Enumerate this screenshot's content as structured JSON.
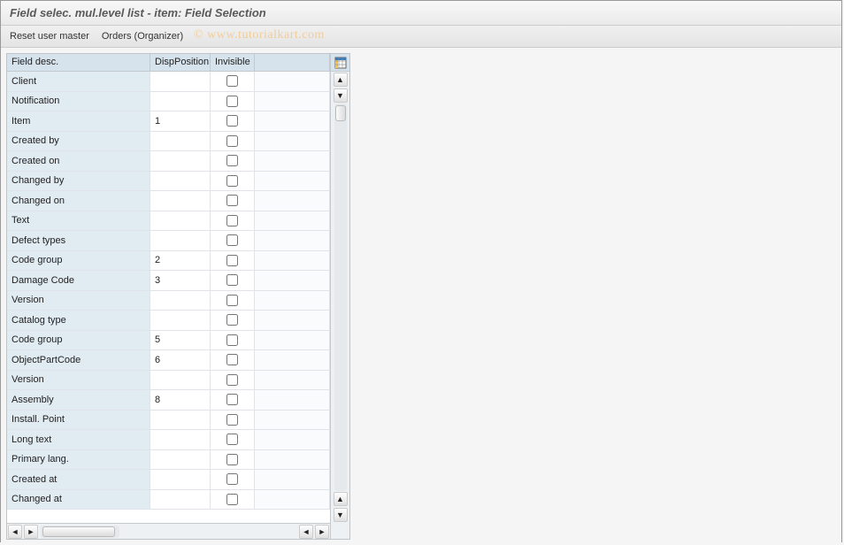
{
  "title": "Field selec. mul.level list - item: Field Selection",
  "toolbar": {
    "reset_user_master": "Reset user master",
    "orders_organizer": "Orders (Organizer)"
  },
  "watermark": "© www.tutorialkart.com",
  "table": {
    "headers": {
      "field_desc": "Field desc.",
      "disp_position": "DispPosition",
      "invisible": "Invisible"
    },
    "rows": [
      {
        "desc": "Client",
        "pos": "",
        "inv": false
      },
      {
        "desc": "Notification",
        "pos": "",
        "inv": false
      },
      {
        "desc": "Item",
        "pos": "1",
        "inv": false
      },
      {
        "desc": "Created by",
        "pos": "",
        "inv": false
      },
      {
        "desc": "Created on",
        "pos": "",
        "inv": false
      },
      {
        "desc": "Changed by",
        "pos": "",
        "inv": false
      },
      {
        "desc": "Changed on",
        "pos": "",
        "inv": false
      },
      {
        "desc": "Text",
        "pos": "",
        "inv": false
      },
      {
        "desc": "Defect types",
        "pos": "",
        "inv": false
      },
      {
        "desc": "Code group",
        "pos": "2",
        "inv": false
      },
      {
        "desc": "Damage Code",
        "pos": "3",
        "inv": false
      },
      {
        "desc": "Version",
        "pos": "",
        "inv": false
      },
      {
        "desc": "Catalog type",
        "pos": "",
        "inv": false
      },
      {
        "desc": "Code group",
        "pos": "5",
        "inv": false
      },
      {
        "desc": "ObjectPartCode",
        "pos": "6",
        "inv": false
      },
      {
        "desc": "Version",
        "pos": "",
        "inv": false
      },
      {
        "desc": "Assembly",
        "pos": "8",
        "inv": false
      },
      {
        "desc": "Install. Point",
        "pos": "",
        "inv": false
      },
      {
        "desc": "Long text",
        "pos": "",
        "inv": false
      },
      {
        "desc": "Primary lang.",
        "pos": "",
        "inv": false
      },
      {
        "desc": "Created at",
        "pos": "",
        "inv": false
      },
      {
        "desc": "Changed at",
        "pos": "",
        "inv": false
      }
    ]
  },
  "icons": {
    "table_settings": "table-settings-icon"
  }
}
